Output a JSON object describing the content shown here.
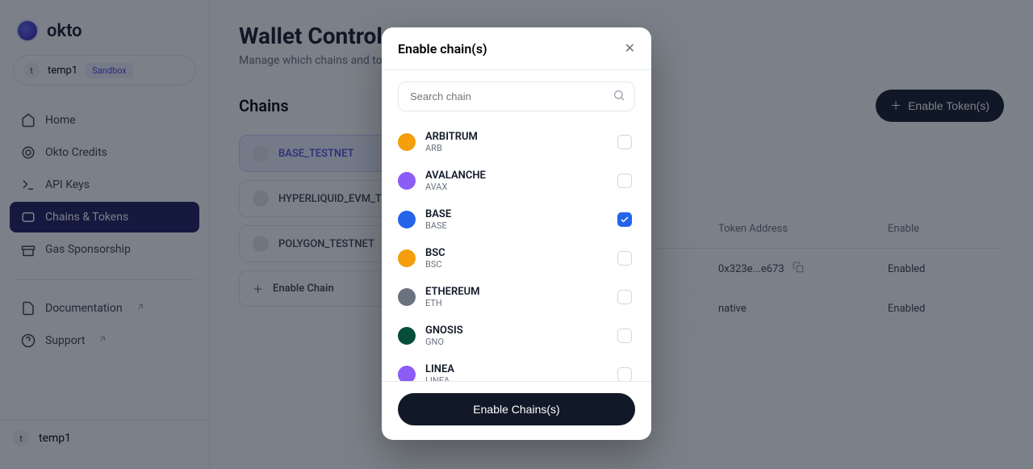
{
  "brand": {
    "name": "okto"
  },
  "org": {
    "avatar_letter": "t",
    "name": "temp1",
    "badge": "Sandbox"
  },
  "sidebar": {
    "items": [
      {
        "label": "Home",
        "icon": "home"
      },
      {
        "label": "Okto Credits",
        "icon": "credits"
      },
      {
        "label": "API Keys",
        "icon": "apikeys"
      },
      {
        "label": "Chains & Tokens",
        "icon": "chains",
        "active": true
      },
      {
        "label": "Gas Sponsorship",
        "icon": "gas"
      }
    ],
    "secondary": [
      {
        "label": "Documentation",
        "icon": "doc",
        "external": true
      },
      {
        "label": "Support",
        "icon": "support",
        "external": true
      }
    ],
    "footer": {
      "avatar_letter": "t",
      "name": "temp1"
    }
  },
  "page": {
    "title": "Wallet Controls",
    "subtitle": "Manage which chains and tokens your users can access.",
    "chains_section_title": "Chains",
    "enable_tokens_button": "Enable Token(s)",
    "chains": [
      {
        "label": "BASE_TESTNET",
        "selected": true
      },
      {
        "label": "HYPERLIQUID_EVM_TESTNET"
      },
      {
        "label": "POLYGON_TESTNET"
      },
      {
        "label": "Enable Chain",
        "is_action": true
      }
    ],
    "table": {
      "headers": [
        "Token Address",
        "Enable"
      ],
      "rows": [
        {
          "address": "0x323e...e673",
          "status": "Enabled",
          "copyable": true
        },
        {
          "address": "native",
          "status": "Enabled",
          "copyable": false
        }
      ]
    }
  },
  "modal": {
    "title": "Enable chain(s)",
    "search_placeholder": "Search chain",
    "submit_label": "Enable Chains(s)",
    "chains": [
      {
        "name": "ARBITRUM",
        "symbol": "ARB",
        "color": "#f59e0b",
        "checked": false
      },
      {
        "name": "AVALANCHE",
        "symbol": "AVAX",
        "color": "#8b5cf6",
        "checked": false
      },
      {
        "name": "BASE",
        "symbol": "BASE",
        "color": "#2563eb",
        "checked": true
      },
      {
        "name": "BSC",
        "symbol": "BSC",
        "color": "#f59e0b",
        "checked": false
      },
      {
        "name": "ETHEREUM",
        "symbol": "ETH",
        "color": "#6b7280",
        "checked": false
      },
      {
        "name": "GNOSIS",
        "symbol": "GNO",
        "color": "#064e3b",
        "checked": false
      },
      {
        "name": "LINEA",
        "symbol": "LINEA",
        "color": "#8b5cf6",
        "checked": false
      }
    ]
  }
}
